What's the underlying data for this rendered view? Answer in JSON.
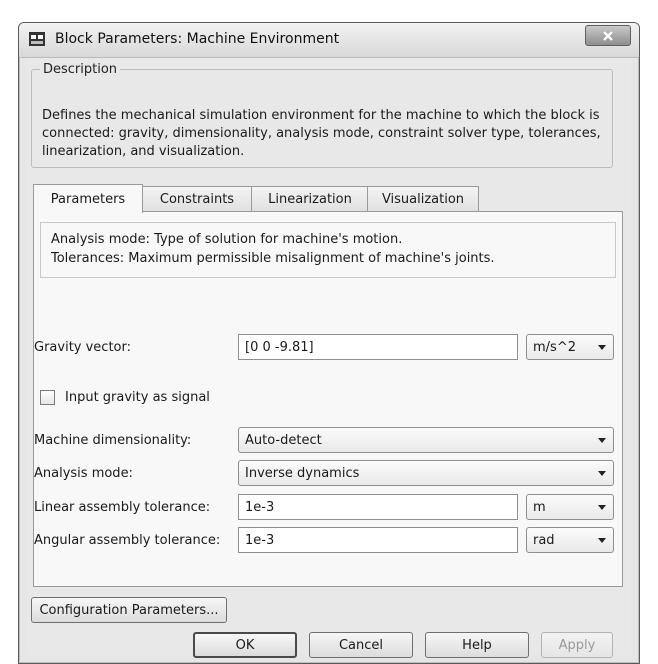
{
  "window": {
    "title": "Block Parameters: Machine Environment",
    "icon": "simulink-block-icon",
    "close_icon": "close-x-icon"
  },
  "description": {
    "legend": "Description",
    "text": "Defines the mechanical simulation environment for the machine to which the block is connected: gravity, dimensionality, analysis mode, constraint solver type, tolerances, linearization, and visualization."
  },
  "tabs": [
    {
      "label": "Parameters",
      "active": true
    },
    {
      "label": "Constraints",
      "active": false
    },
    {
      "label": "Linearization",
      "active": false
    },
    {
      "label": "Visualization",
      "active": false
    }
  ],
  "info": {
    "line1": "Analysis mode: Type of solution for machine's motion.",
    "line2": "Tolerances: Maximum permissible misalignment of machine's joints."
  },
  "params": {
    "gravity": {
      "label": "Gravity vector:",
      "value": "[0 0 -9.81]",
      "unit": "m/s^2"
    },
    "gravity_signal": {
      "label": "Input gravity as signal",
      "checked": false
    },
    "dimensionality": {
      "label": "Machine dimensionality:",
      "value": "Auto-detect"
    },
    "analysis_mode": {
      "label": "Analysis mode:",
      "value": "Inverse dynamics"
    },
    "linear_tol": {
      "label": "Linear assembly tolerance:",
      "value": "1e-3",
      "unit": "m"
    },
    "angular_tol": {
      "label": "Angular assembly tolerance:",
      "value": "1e-3",
      "unit": "rad"
    }
  },
  "buttons": {
    "config": "Configuration Parameters...",
    "ok": "OK",
    "cancel": "Cancel",
    "help": "Help",
    "apply": "Apply"
  }
}
